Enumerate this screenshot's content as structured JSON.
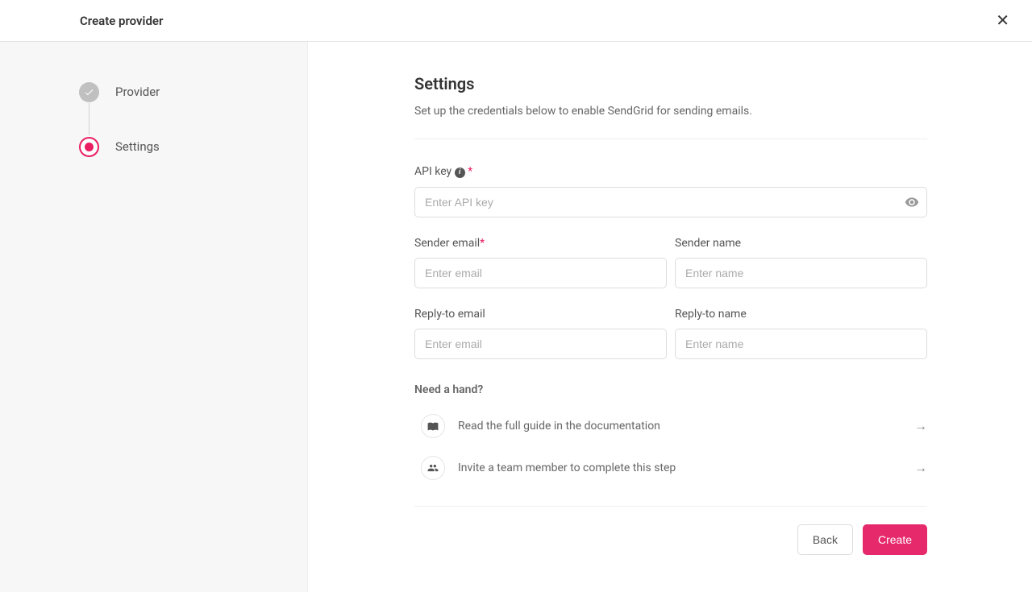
{
  "header": {
    "title": "Create provider"
  },
  "sidebar": {
    "steps": [
      {
        "label": "Provider",
        "status": "done"
      },
      {
        "label": "Settings",
        "status": "active"
      }
    ]
  },
  "settings": {
    "title": "Settings",
    "description": "Set up the credentials below to enable SendGrid for sending emails.",
    "fields": {
      "api_key": {
        "label": "API key",
        "required": true,
        "placeholder": "Enter API key",
        "value": ""
      },
      "sender_email": {
        "label": "Sender email",
        "required": true,
        "placeholder": "Enter email",
        "value": ""
      },
      "sender_name": {
        "label": "Sender name",
        "required": false,
        "placeholder": "Enter name",
        "value": ""
      },
      "reply_to_email": {
        "label": "Reply-to email",
        "required": false,
        "placeholder": "Enter email",
        "value": ""
      },
      "reply_to_name": {
        "label": "Reply-to name",
        "required": false,
        "placeholder": "Enter name",
        "value": ""
      }
    },
    "help": {
      "title": "Need a hand?",
      "items": [
        {
          "text": "Read the full guide in the documentation",
          "icon": "book"
        },
        {
          "text": "Invite a team member to complete this step",
          "icon": "users"
        }
      ]
    },
    "buttons": {
      "back": "Back",
      "create": "Create"
    }
  }
}
